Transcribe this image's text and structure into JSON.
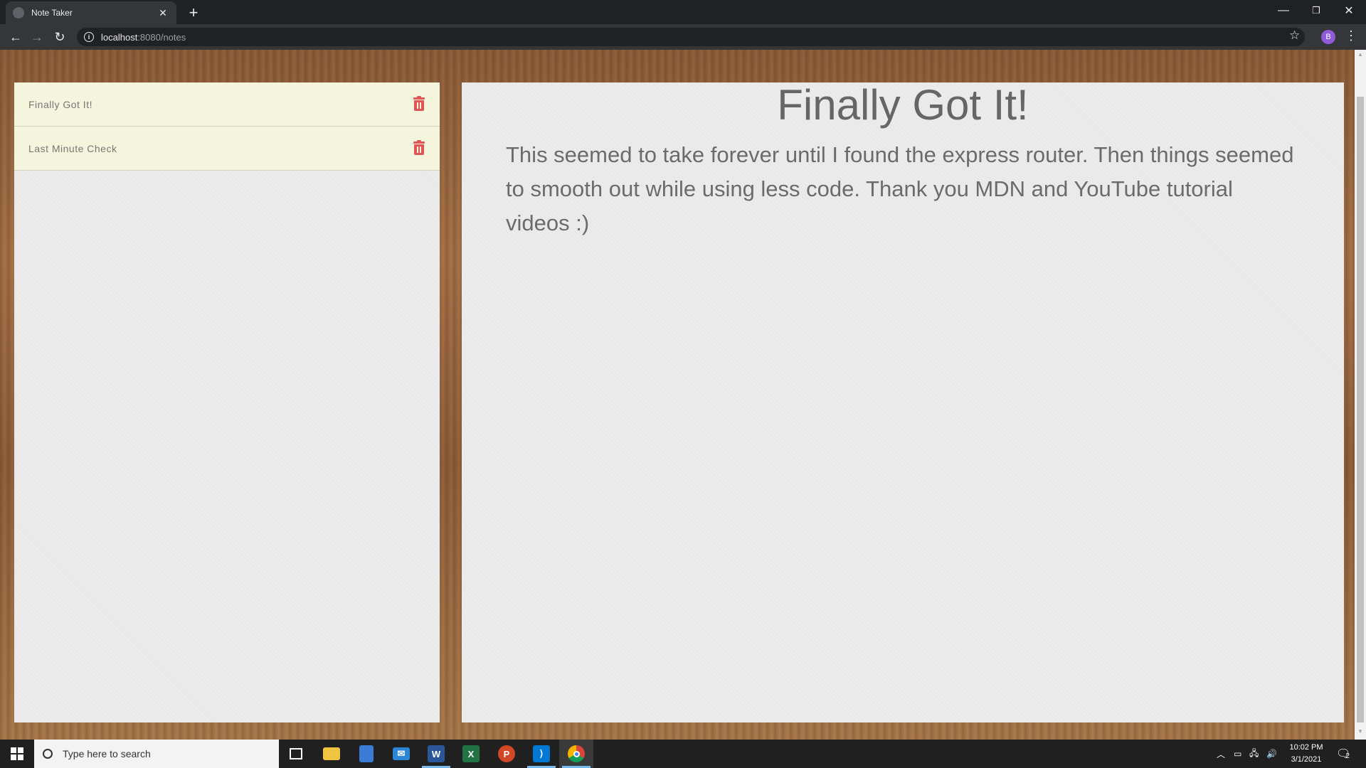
{
  "browser": {
    "tab_title": "Note Taker",
    "new_tab": "+",
    "url_host": "localhost",
    "url_path": ":8080/notes",
    "profile_initial": "B"
  },
  "notes": [
    {
      "title": "Finally Got It!"
    },
    {
      "title": "Last Minute Check"
    }
  ],
  "active_note": {
    "title": "Finally Got It!",
    "text": "This seemed to take forever until I found the express router. Then things seemed to smooth out while using less code. Thank you MDN and YouTube tutorial videos :)"
  },
  "taskbar": {
    "search_placeholder": "Type here to search",
    "time": "10:02 PM",
    "date": "3/1/2021",
    "notification_count": "2",
    "apps": [
      "task-view",
      "file-explorer",
      "store",
      "mail",
      "word",
      "excel",
      "powerpoint",
      "vscode",
      "chrome"
    ]
  },
  "colors": {
    "note_item_bg": "#f5f4dc",
    "trash": "#e05555",
    "panel_bg": "#ececec"
  }
}
